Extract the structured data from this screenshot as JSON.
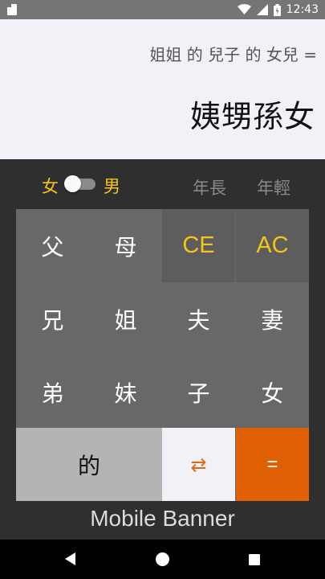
{
  "status_bar": {
    "time": "12:43",
    "icons": [
      "sd-card-icon",
      "wifi-icon",
      "signal-icon",
      "battery-icon"
    ]
  },
  "display": {
    "expression": "姐姐 的 兒子 的 女兒 =",
    "result": "姨甥孫女"
  },
  "options": {
    "gender_female": "女",
    "gender_male": "男",
    "age_older": "年長",
    "age_younger": "年輕"
  },
  "keypad": {
    "father": "父",
    "mother": "母",
    "clear_entry": "CE",
    "all_clear": "AC",
    "older_brother": "兄",
    "older_sister": "姐",
    "husband": "夫",
    "wife": "妻",
    "younger_brother": "弟",
    "younger_sister": "妹",
    "son": "子",
    "daughter": "女",
    "of": "的",
    "swap": "⇄",
    "equals": "="
  },
  "banner": {
    "text": "Mobile Banner"
  },
  "colors": {
    "accent_yellow": "#f4c617",
    "equals_orange": "#e06004",
    "swap_orange": "#e06a08",
    "keypad_gray": "#686868"
  }
}
